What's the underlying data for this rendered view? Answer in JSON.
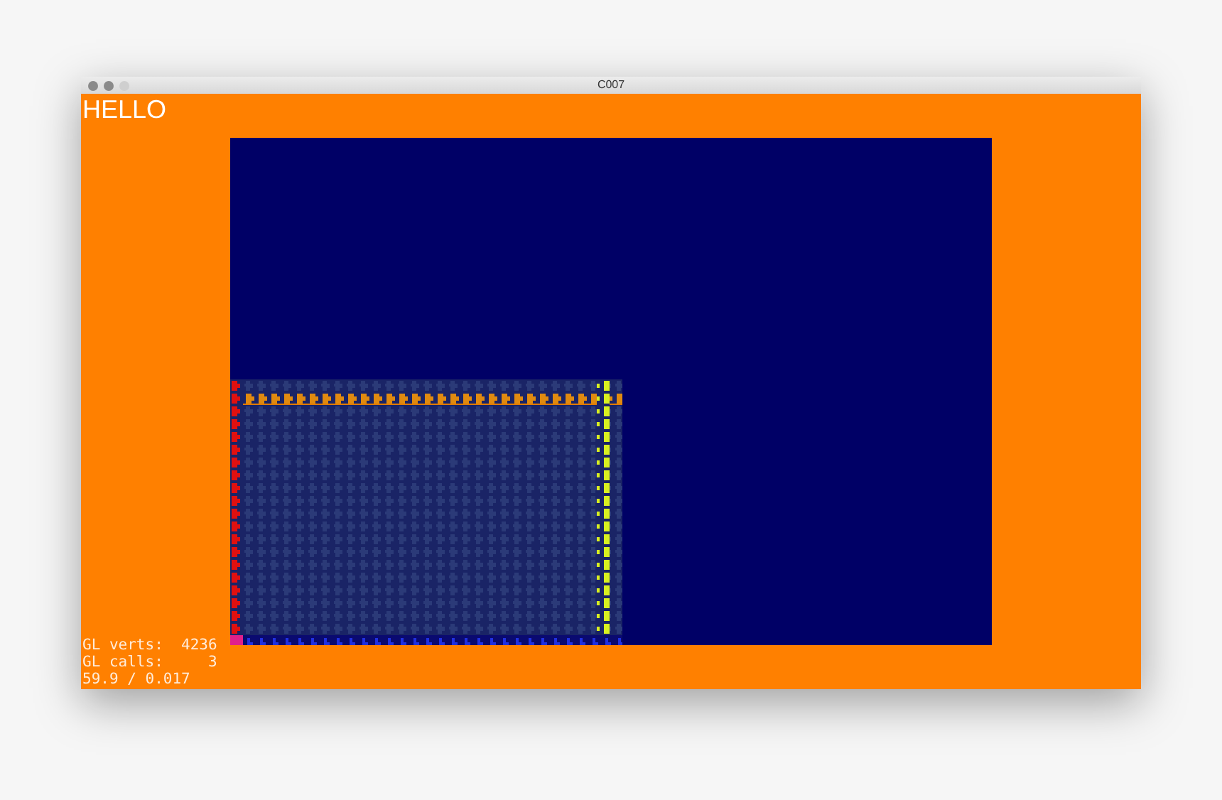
{
  "window": {
    "title": "C007"
  },
  "label": "HELLO",
  "stats": [
    "GL verts:  4236",
    "GL calls:     3",
    "59.9 / 0.017"
  ]
}
